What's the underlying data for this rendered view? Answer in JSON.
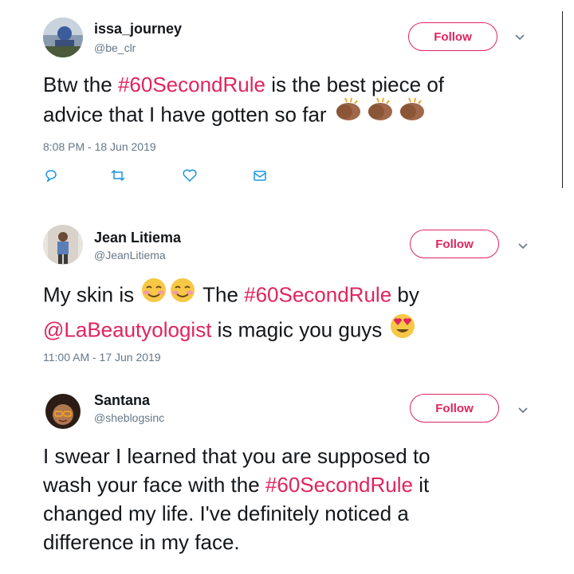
{
  "tweets": [
    {
      "name": "issa_journey",
      "handle": "@be_clr",
      "follow_label": "Follow",
      "text": {
        "line1_pre": "Btw the ",
        "hashtag": "#60SecondRule",
        "line1_post": " is the best piece of",
        "line2": "advice that I have gotten so far"
      },
      "emoji": [
        "clapping-hands-icon",
        "clapping-hands-icon",
        "clapping-hands-icon"
      ],
      "timestamp": "8:08 PM - 18 Jun 2019",
      "actions": [
        "reply-icon",
        "retweet-icon",
        "like-icon",
        "message-icon"
      ]
    },
    {
      "name": "Jean Litiema",
      "handle": "@JeanLitiema",
      "follow_label": "Follow",
      "text": {
        "part1": "My skin is ",
        "part2": " The ",
        "hashtag": "#60SecondRule",
        "part3": " by",
        "mention": "@LaBeautyologist",
        "part4": " is magic you guys "
      },
      "emoji": [
        "smiling-face-icon",
        "smiling-face-icon",
        "heart-eyes-icon"
      ],
      "timestamp": "11:00 AM - 17 Jun 2019"
    },
    {
      "name": "Santana",
      "handle": "@sheblogsinc",
      "follow_label": "Follow",
      "text": {
        "line1": "I swear I learned that you are supposed to",
        "line2_pre": "wash your face with the ",
        "hashtag": "#60SecondRule",
        "line2_post": " it",
        "line3": "changed my life. I've definitely noticed a",
        "line4": "difference in my face."
      }
    }
  ],
  "colors": {
    "accent": "#e0245e",
    "secondary": "#657786",
    "text": "#14171a"
  }
}
